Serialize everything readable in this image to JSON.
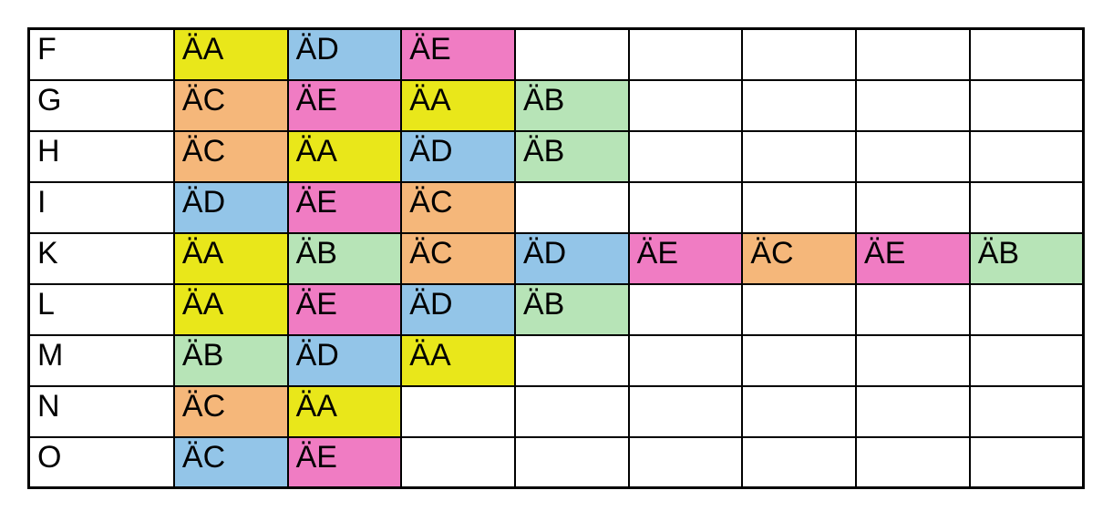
{
  "colors": {
    "ÄA": "c-yellow",
    "ÄB": "c-green",
    "ÄC": "c-orange",
    "ÄD": "c-blue",
    "ÄE": "c-pink"
  },
  "overrides": {
    "8-1": "c-blue"
  },
  "columns": 8,
  "rows": [
    {
      "label": "F",
      "cells": [
        "ÄA",
        "ÄD",
        "ÄE",
        "",
        "",
        "",
        "",
        ""
      ]
    },
    {
      "label": "G",
      "cells": [
        "ÄC",
        "ÄE",
        "ÄA",
        "ÄB",
        "",
        "",
        "",
        ""
      ]
    },
    {
      "label": "H",
      "cells": [
        "ÄC",
        "ÄA",
        "ÄD",
        "ÄB",
        "",
        "",
        "",
        ""
      ]
    },
    {
      "label": "I",
      "cells": [
        "ÄD",
        "ÄE",
        "ÄC",
        "",
        "",
        "",
        "",
        ""
      ]
    },
    {
      "label": "K",
      "cells": [
        "ÄA",
        "ÄB",
        "ÄC",
        "ÄD",
        "ÄE",
        "ÄC",
        "ÄE",
        "ÄB"
      ]
    },
    {
      "label": "L",
      "cells": [
        "ÄA",
        "ÄE",
        "ÄD",
        "ÄB",
        "",
        "",
        "",
        ""
      ]
    },
    {
      "label": "M",
      "cells": [
        "ÄB",
        "ÄD",
        "ÄA",
        "",
        "",
        "",
        "",
        ""
      ]
    },
    {
      "label": "N",
      "cells": [
        "ÄC",
        "ÄA",
        "",
        "",
        "",
        "",
        "",
        ""
      ]
    },
    {
      "label": "O",
      "cells": [
        "ÄC",
        "ÄE",
        "",
        "",
        "",
        "",
        "",
        ""
      ]
    }
  ]
}
